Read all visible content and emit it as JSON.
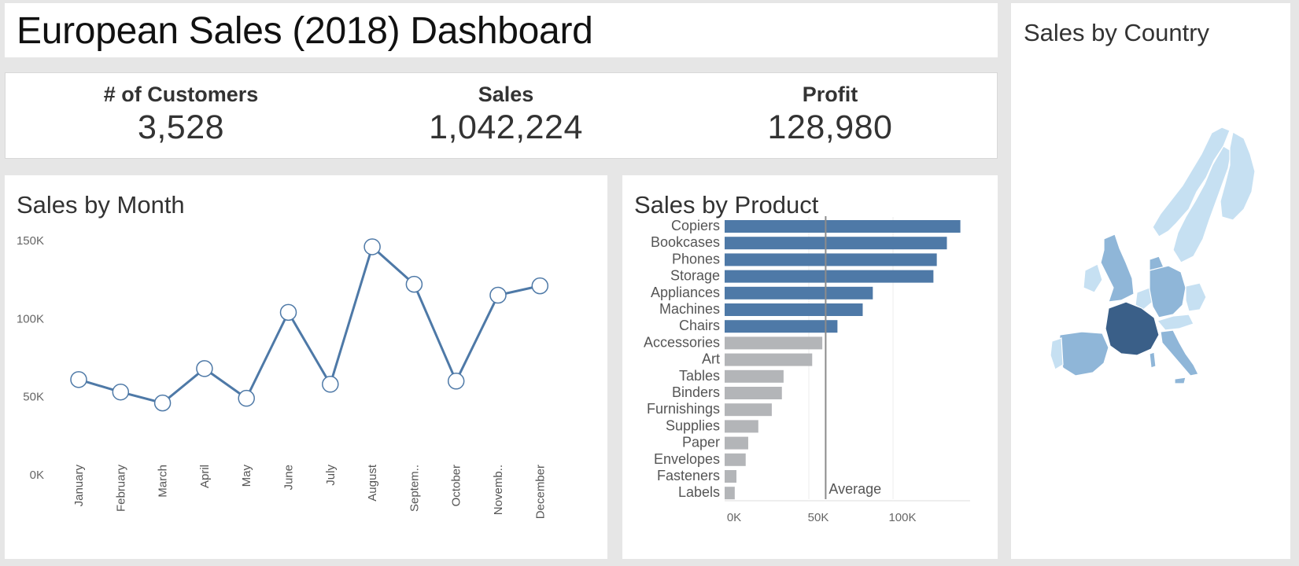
{
  "dashboard": {
    "title": "European Sales (2018) Dashboard"
  },
  "kpis": {
    "customers": {
      "label": "# of Customers",
      "value": "3,528"
    },
    "sales": {
      "label": "Sales",
      "value": "1,042,224"
    },
    "profit": {
      "label": "Profit",
      "value": "128,980"
    }
  },
  "sales_by_month": {
    "title": "Sales by Month"
  },
  "sales_by_product": {
    "title": "Sales by Product",
    "reference_line_label": "Average"
  },
  "sales_by_country": {
    "title": "Sales by Country"
  },
  "colors": {
    "line": "#4e79a7",
    "bar_above_average": "#4e79a7",
    "bar_below_average": "#b3b5b8",
    "map_light": "#c6e0f2",
    "map_medium": "#8fb6d8",
    "map_dark": "#4b6f96",
    "map_darkest": "#3a5f88"
  },
  "chart_data": [
    {
      "type": "line",
      "x": [
        "January",
        "February",
        "March",
        "April",
        "May",
        "June",
        "July",
        "August",
        "Septem..",
        "October",
        "Novemb..",
        "December"
      ],
      "y": [
        61000,
        53000,
        46000,
        68000,
        49000,
        104000,
        58000,
        146000,
        122000,
        60000,
        115000,
        121000
      ],
      "yticks": [
        "0K",
        "50K",
        "100K",
        "150K"
      ],
      "ylim": [
        0,
        150000
      ],
      "markers": "circle",
      "grid": false
    },
    {
      "type": "bar",
      "orientation": "horizontal",
      "categories": [
        "Copiers",
        "Bookcases",
        "Phones",
        "Storage",
        "Appliances",
        "Machines",
        "Chairs",
        "Accessories",
        "Art",
        "Tables",
        "Binders",
        "Furnishings",
        "Supplies",
        "Paper",
        "Envelopes",
        "Fasteners",
        "Labels"
      ],
      "values": [
        140000,
        132000,
        126000,
        124000,
        88000,
        82000,
        67000,
        58000,
        52000,
        35000,
        34000,
        28000,
        20000,
        14000,
        12500,
        7000,
        6000
      ],
      "xticks": [
        "0K",
        "50K",
        "100K"
      ],
      "xlim": [
        0,
        145000
      ],
      "reference_line": {
        "label": "Average",
        "value": 60000
      },
      "grid": "vertical"
    }
  ]
}
